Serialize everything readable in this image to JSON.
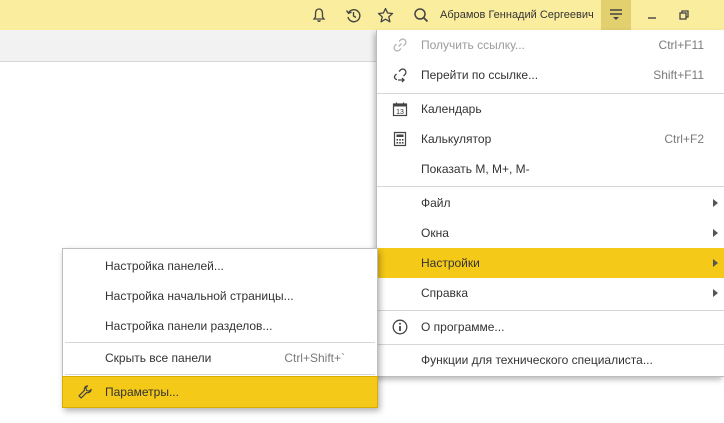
{
  "topbar": {
    "user_name": "Абрамов Геннадий Сергеевич",
    "icons": [
      "bell-icon",
      "history-icon",
      "star-icon",
      "search-icon",
      "menu-icon",
      "minimize-icon",
      "restore-icon"
    ],
    "accent": "#fbed9e"
  },
  "main_menu": {
    "items": [
      {
        "label": "Получить ссылку...",
        "shortcut": "Ctrl+F11",
        "icon": "link-icon",
        "disabled": true
      },
      {
        "label": "Перейти по ссылке...",
        "shortcut": "Shift+F11",
        "icon": "go-link-icon"
      },
      {
        "label": "Календарь",
        "shortcut": "",
        "icon": "calendar-icon",
        "calendar_day": "13"
      },
      {
        "label": "Калькулятор",
        "shortcut": "Ctrl+F2",
        "icon": "calculator-icon"
      },
      {
        "label": "Показать M, M+, M-",
        "shortcut": ""
      },
      {
        "label": "Файл",
        "submenu": true
      },
      {
        "label": "Окна",
        "submenu": true
      },
      {
        "label": "Настройки",
        "submenu": true,
        "active": true
      },
      {
        "label": "Справка",
        "submenu": true
      },
      {
        "label": "О программе...",
        "icon": "info-icon"
      },
      {
        "label": "Функции для технического специалиста..."
      }
    ]
  },
  "sub_menu": {
    "items": [
      {
        "label": "Настройка панелей..."
      },
      {
        "label": "Настройка начальной страницы..."
      },
      {
        "label": "Настройка панели разделов..."
      },
      {
        "label": "Скрыть все панели",
        "shortcut": "Ctrl+Shift+`"
      },
      {
        "label": "Параметры...",
        "icon": "wrench-icon",
        "active": true
      }
    ]
  },
  "colors": {
    "highlight": "#f5c918",
    "topbar": "#fbed9e"
  }
}
